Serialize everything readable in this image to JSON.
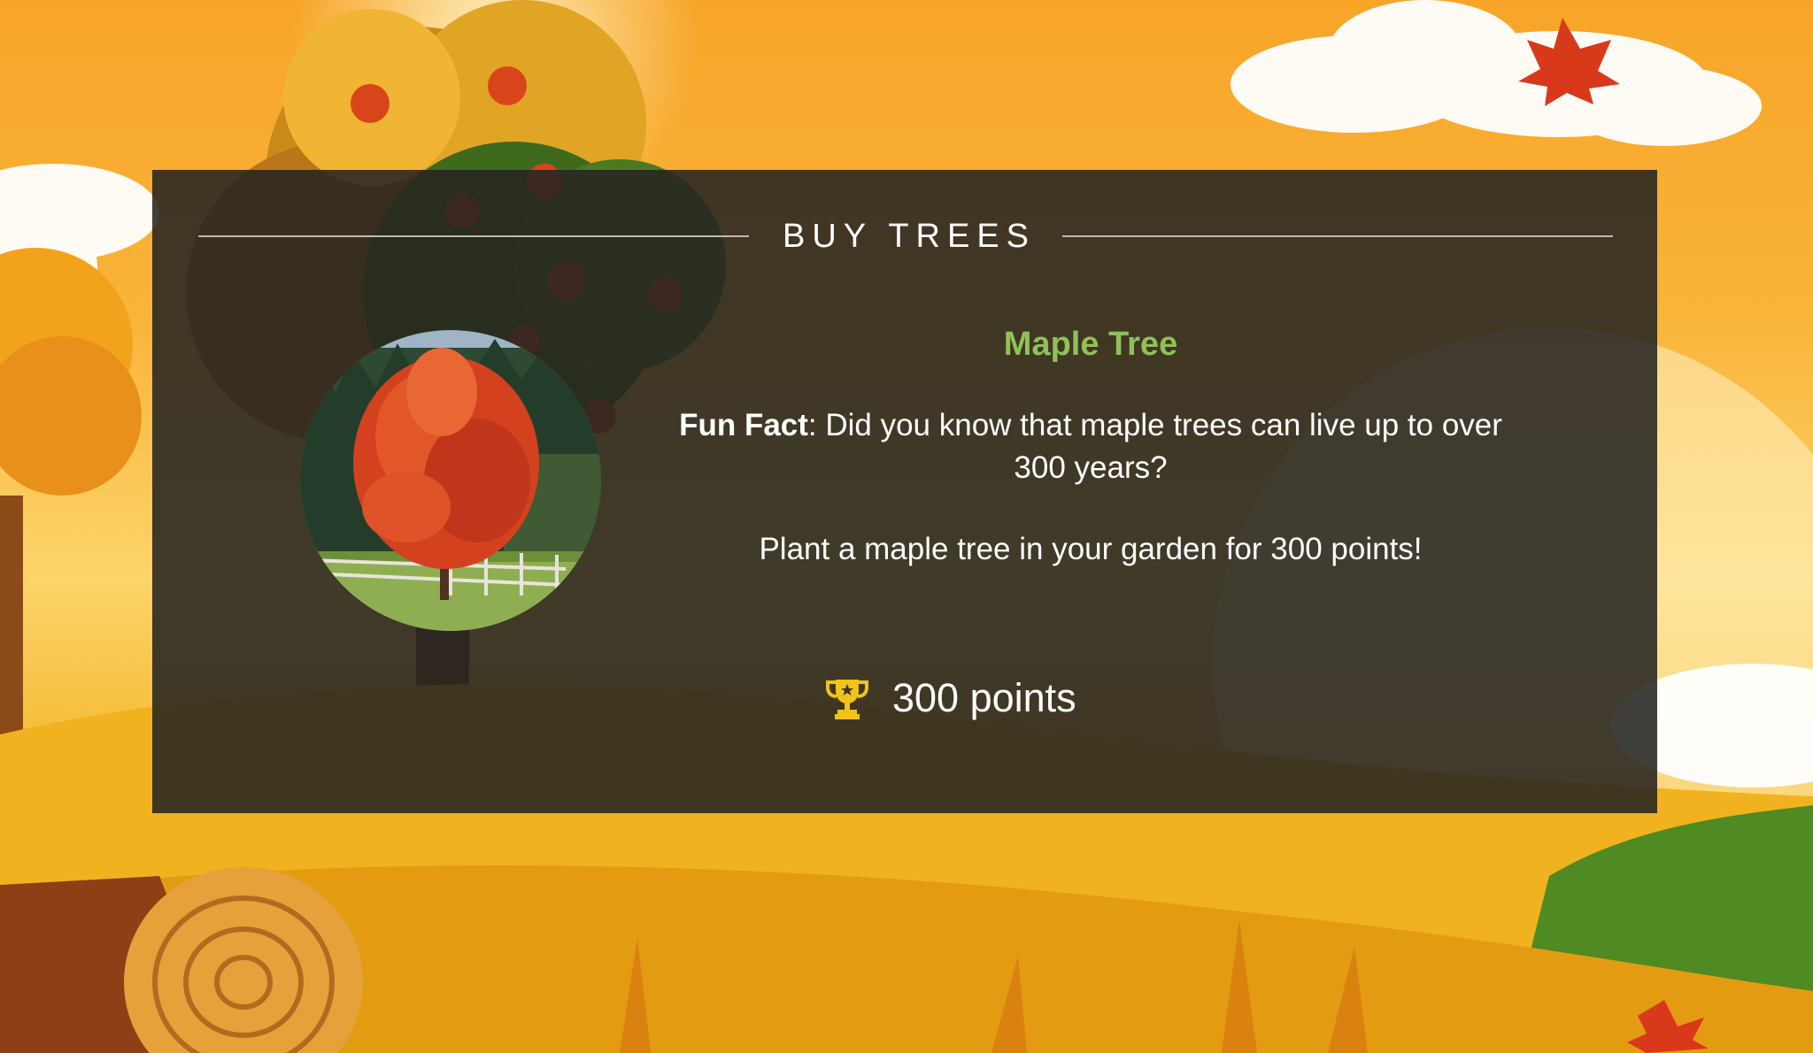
{
  "header": {
    "title": "BUY TREES"
  },
  "item": {
    "name": "Maple Tree",
    "image_icon": "maple-tree-photo",
    "fact_label": "Fun Fact",
    "fact_text": ": Did you know that maple trees can live up to over 300 years?",
    "offer_text": "Plant a maple tree in your garden for 300 points!",
    "price_icon": "trophy-icon",
    "price_text": "300 points"
  },
  "colors": {
    "panel": "#262421",
    "accent_green": "#8fc158",
    "trophy": "#f2c318"
  }
}
